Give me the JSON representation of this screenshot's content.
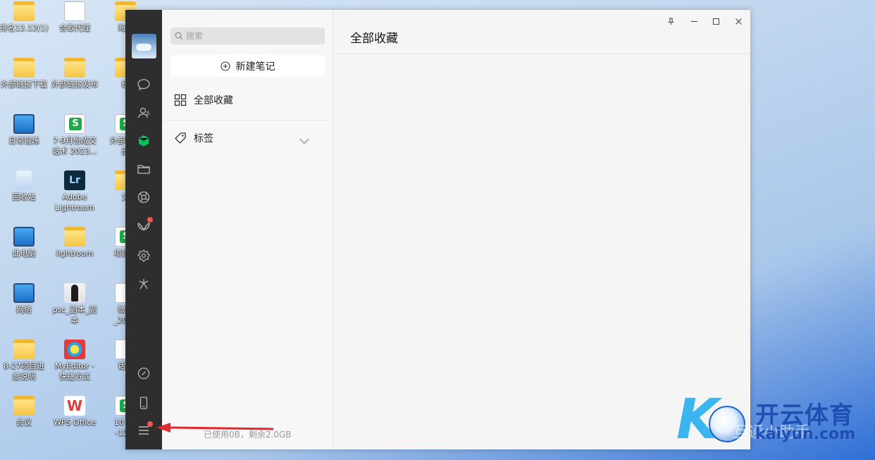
{
  "desktop": {
    "icons": [
      {
        "label": "排名12.12(1)",
        "kind": "folder"
      },
      {
        "label": "合歌代理",
        "kind": "doc"
      },
      {
        "label": "海外",
        "kind": "folder"
      },
      {
        "label": "外部链接下载",
        "kind": "folder"
      },
      {
        "label": "外部链接发布",
        "kind": "folder"
      },
      {
        "label": "经",
        "kind": "folder"
      },
      {
        "label": "日常锻炼",
        "kind": "monitor"
      },
      {
        "label": "7-9月份成交\n话术 2023...",
        "kind": "sheet"
      },
      {
        "label": "外部链接\n册",
        "kind": "sheet"
      },
      {
        "label": "回收站",
        "kind": "bin"
      },
      {
        "label": "Adobe\nLightroom",
        "kind": "lr"
      },
      {
        "label": "文",
        "kind": "folder"
      },
      {
        "label": "此电脑",
        "kind": "monitor"
      },
      {
        "label": "lightroom",
        "kind": "folder"
      },
      {
        "label": "项目进",
        "kind": "sheet"
      },
      {
        "label": "网络",
        "kind": "monitor"
      },
      {
        "label": "psc_副本_副\n本",
        "kind": "person"
      },
      {
        "label": "微信\n_2024",
        "kind": "doc"
      },
      {
        "label": "8-27项目进\n度说明",
        "kind": "folder"
      },
      {
        "label": "MyEditor -\n快捷方式",
        "kind": "my"
      },
      {
        "label": "话题",
        "kind": "doc"
      },
      {
        "label": "会议",
        "kind": "folder"
      },
      {
        "label": "WPS Office",
        "kind": "wps"
      },
      {
        "label": "10（1\n-12月",
        "kind": "sheet"
      }
    ]
  },
  "wechat": {
    "rail": {
      "icons": [
        "chat-icon",
        "contacts-icon",
        "favorites-icon",
        "folder-icon",
        "moments-icon",
        "channels-icon",
        "mini-program-icon",
        "search-spark-icon",
        "link-icon",
        "phone-icon",
        "menu-icon"
      ]
    },
    "search": {
      "placeholder": "搜索"
    },
    "new_note": {
      "label": "新建笔记"
    },
    "nav": {
      "all_favorites": "全部收藏",
      "tags": "标签"
    },
    "storage_text": "已使用0B，剩余2.0GB",
    "content": {
      "title": "全部收藏"
    },
    "window_controls": [
      "pin-icon",
      "minimize-icon",
      "maximize-icon",
      "close-icon"
    ]
  },
  "watermark": {
    "brand_cn": "开云体育",
    "brand_en": "kaiyun.com",
    "gray_text": "互通小助手"
  },
  "colors": {
    "rail_bg": "#2e2e2e",
    "active_green": "#07c160",
    "badge_red": "#f05454",
    "arrow_red": "#e0282e"
  }
}
